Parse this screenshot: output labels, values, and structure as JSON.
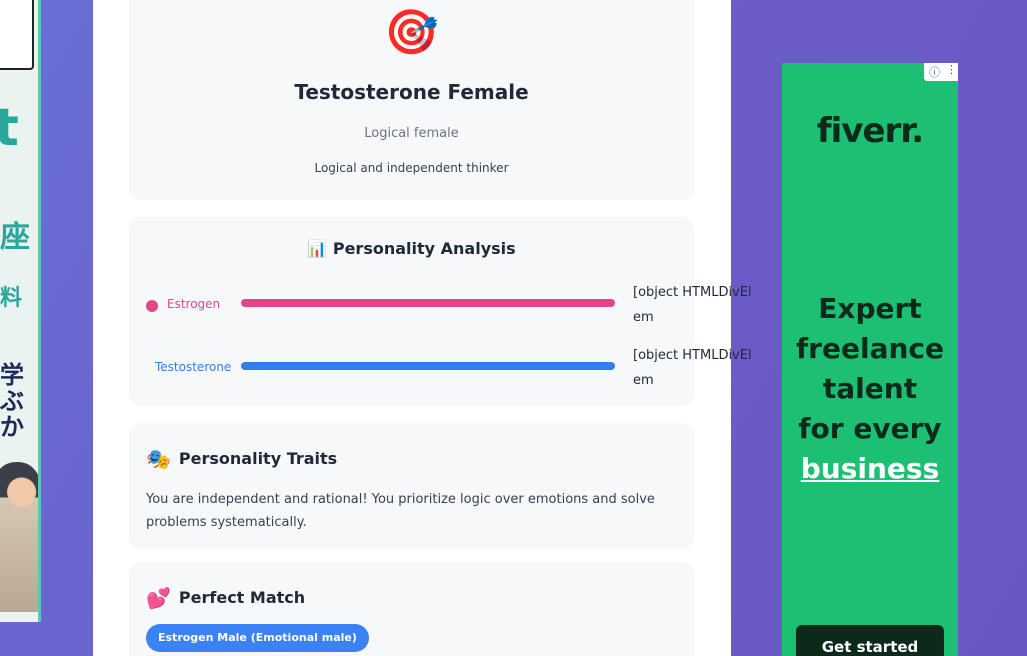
{
  "left_ad": {
    "big_letter": "t",
    "line1": "座",
    "line2": "料",
    "line3": "学ぶか"
  },
  "result": {
    "emoji": "🎯",
    "title": "Testosterone Female",
    "subtitle": "Logical female",
    "description": "Logical and independent thinker"
  },
  "analysis": {
    "icon": "📊",
    "heading": "Personality Analysis",
    "meters": [
      {
        "label": "Estrogen",
        "value_text": "[object HTMLDivElem",
        "fill": 1.0
      },
      {
        "label": "Testosterone",
        "value_text": "[object HTMLDivElem",
        "fill": 1.0
      }
    ]
  },
  "traits": {
    "icon": "🎭",
    "heading": "Personality Traits",
    "text": "You are independent and rational! You prioritize logic over emotions and solve problems systematically."
  },
  "match": {
    "icon": "💕",
    "heading": "Perfect Match",
    "pill": "Estrogen Male (Emotional male)"
  },
  "right_ad": {
    "brand": "fiverr.",
    "headline_1": "Expert",
    "headline_2": "freelance",
    "headline_3": "talent",
    "headline_4": "for every",
    "headline_5": "business",
    "cta": "Get started",
    "adchoice_i": "ⓘ",
    "adchoice_menu": "⋮"
  },
  "colors": {
    "estrogen": "#e3478a",
    "testosterone": "#2f80ed",
    "fiverr_green": "#1dbf73"
  }
}
